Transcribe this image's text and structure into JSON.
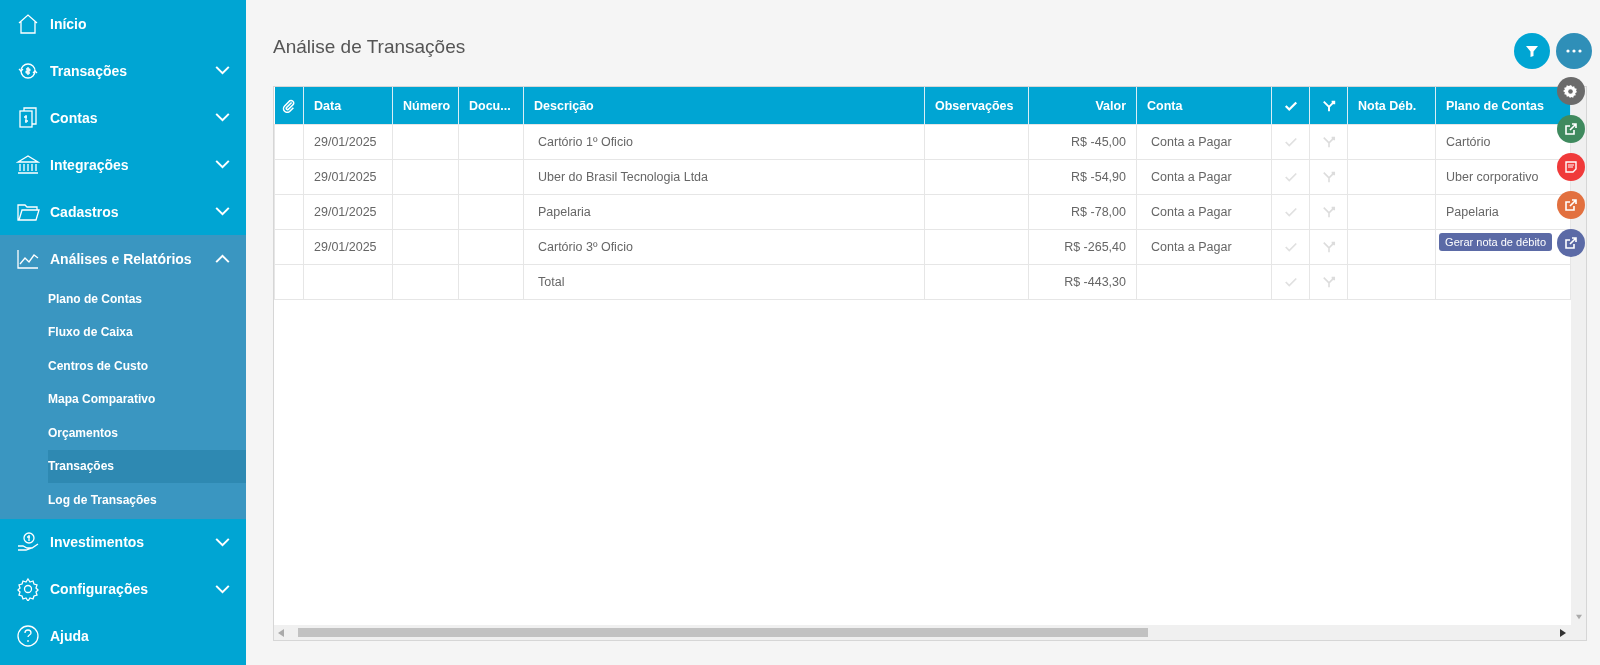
{
  "sidebar": {
    "items": [
      {
        "label": "Início",
        "kind": "home"
      },
      {
        "label": "Transações",
        "kind": "cycle",
        "expanded": false
      },
      {
        "label": "Contas",
        "kind": "docs",
        "expanded": false
      },
      {
        "label": "Integrações",
        "kind": "bank",
        "expanded": false
      },
      {
        "label": "Cadastros",
        "kind": "folder",
        "expanded": false
      },
      {
        "label": "Análises e Relatórios",
        "kind": "chart",
        "expanded": true,
        "children": [
          {
            "label": "Plano de Contas",
            "selected": false
          },
          {
            "label": "Fluxo de Caixa",
            "selected": false
          },
          {
            "label": "Centros de Custo",
            "selected": false
          },
          {
            "label": "Mapa Comparativo",
            "selected": false
          },
          {
            "label": "Orçamentos",
            "selected": false
          },
          {
            "label": "Transações",
            "selected": true
          },
          {
            "label": "Log de Transações",
            "selected": false
          }
        ]
      },
      {
        "label": "Investimentos",
        "kind": "hand",
        "expanded": false
      },
      {
        "label": "Configurações",
        "kind": "gear",
        "expanded": false
      },
      {
        "label": "Ajuda",
        "kind": "help"
      }
    ]
  },
  "page": {
    "title": "Análise de Transações"
  },
  "table": {
    "columns": [
      {
        "kind": "clip"
      },
      {
        "kind": "text",
        "label": "Data"
      },
      {
        "kind": "text",
        "label": "Número"
      },
      {
        "kind": "text",
        "label": "Docu..."
      },
      {
        "kind": "text",
        "label": "Descrição"
      },
      {
        "kind": "text",
        "label": "Observações"
      },
      {
        "kind": "num",
        "label": "Valor"
      },
      {
        "kind": "text",
        "label": "Conta"
      },
      {
        "kind": "check"
      },
      {
        "kind": "merge"
      },
      {
        "kind": "text",
        "label": "Nota Déb."
      },
      {
        "kind": "text",
        "label": "Plano de Contas"
      }
    ],
    "rows": [
      {
        "data": "29/01/2025",
        "descricao": "Cartório 1º Oficio",
        "valor": "R$ -45,00",
        "conta": "Conta a Pagar",
        "plano": "Cartório"
      },
      {
        "data": "29/01/2025",
        "descricao": "Uber do Brasil Tecnologia Ltda",
        "valor": "R$ -54,90",
        "conta": "Conta a Pagar",
        "plano": "Uber corporativo"
      },
      {
        "data": "29/01/2025",
        "descricao": "Papelaria",
        "valor": "R$ -78,00",
        "conta": "Conta a Pagar",
        "plano": "Papelaria"
      },
      {
        "data": "29/01/2025",
        "descricao": "Cartório 3º Oficio",
        "valor": "R$ -265,40",
        "conta": "Conta a Pagar"
      },
      {
        "descricao": "Total",
        "valor": "R$ -443,30"
      }
    ]
  },
  "actions": [
    {
      "kind": "settings",
      "color": "#6b6b6b"
    },
    {
      "kind": "export",
      "color": "#3f8a5e"
    },
    {
      "kind": "pdf",
      "color": "#f03a3a"
    },
    {
      "kind": "export",
      "color": "#e2703f"
    },
    {
      "kind": "export",
      "color": "#5b6aa6",
      "tooltip": "Gerar nota de débito"
    }
  ]
}
